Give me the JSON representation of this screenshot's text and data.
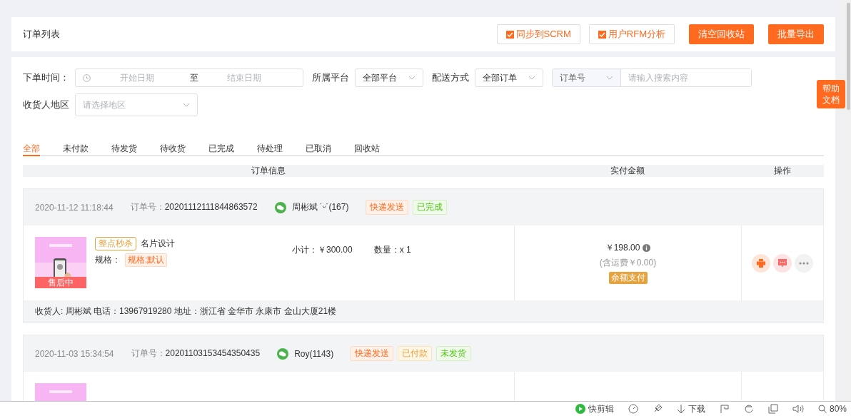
{
  "header": {
    "title": "订单列表",
    "buttons": [
      {
        "label": "同步到SCRM",
        "kind": "outline"
      },
      {
        "label": "用户RFM分析",
        "kind": "outline"
      },
      {
        "label": "清空回收站",
        "kind": "primary"
      },
      {
        "label": "批量导出",
        "kind": "primary"
      }
    ]
  },
  "filters": {
    "order_time": {
      "label": "下单时间：",
      "start_placeholder": "开始日期",
      "separator": "至",
      "end_placeholder": "结束日期"
    },
    "platform": {
      "label": "所属平台",
      "value": "全部平台"
    },
    "delivery": {
      "label": "配送方式",
      "value": "全部订单"
    },
    "search": {
      "type": "订单号",
      "placeholder": "请输入搜索内容"
    },
    "region": {
      "label": "收货人地区",
      "placeholder": "请选择地区"
    }
  },
  "tabs": [
    {
      "label": "全部",
      "selected": true
    },
    {
      "label": "未付款",
      "selected": false
    },
    {
      "label": "待发货",
      "selected": false
    },
    {
      "label": "待收货",
      "selected": false
    },
    {
      "label": "已完成",
      "selected": false
    },
    {
      "label": "待处理",
      "selected": false
    },
    {
      "label": "已取消",
      "selected": false
    },
    {
      "label": "回收站",
      "selected": false
    }
  ],
  "table": {
    "columns": [
      "订单信息",
      "实付金额",
      "操作"
    ]
  },
  "orders": [
    {
      "time": "2020-11-12 11:18:44",
      "order_no_label": "订单号：",
      "order_no": "20201112111844863572",
      "buyer": "周彬斌 ˙ᵕ˙(167)",
      "tags": [
        {
          "label": "快递发送",
          "kind": "delivery"
        },
        {
          "label": "已完成",
          "kind": "success"
        }
      ],
      "item": {
        "badge": "售后中",
        "promo": "整点秒杀",
        "name": "名片设计",
        "spec_label": "规格：",
        "spec": "规格:默认",
        "subtotal": "小计：￥300.00",
        "quantity": "数量：x 1"
      },
      "price": "￥198.00",
      "shipping": "(含运费￥0.00)",
      "payment": "余额支付",
      "receiver": "收货人: 周彬斌 电话：13967919280 地址：浙江省 金华市 永康市 金山大厦21楼"
    },
    {
      "time": "2020-11-03 15:34:54",
      "order_no_label": "订单号：",
      "order_no": "20201103153454350435",
      "buyer": "Roy(1143)",
      "tags": [
        {
          "label": "快递发送",
          "kind": "delivery"
        },
        {
          "label": "已付款",
          "kind": "warning"
        },
        {
          "label": "未发货",
          "kind": "success"
        }
      ]
    }
  ],
  "help_button": "帮助文档",
  "status_bar": {
    "app": "快剪辑",
    "download": "下载",
    "zoom": "80%"
  }
}
